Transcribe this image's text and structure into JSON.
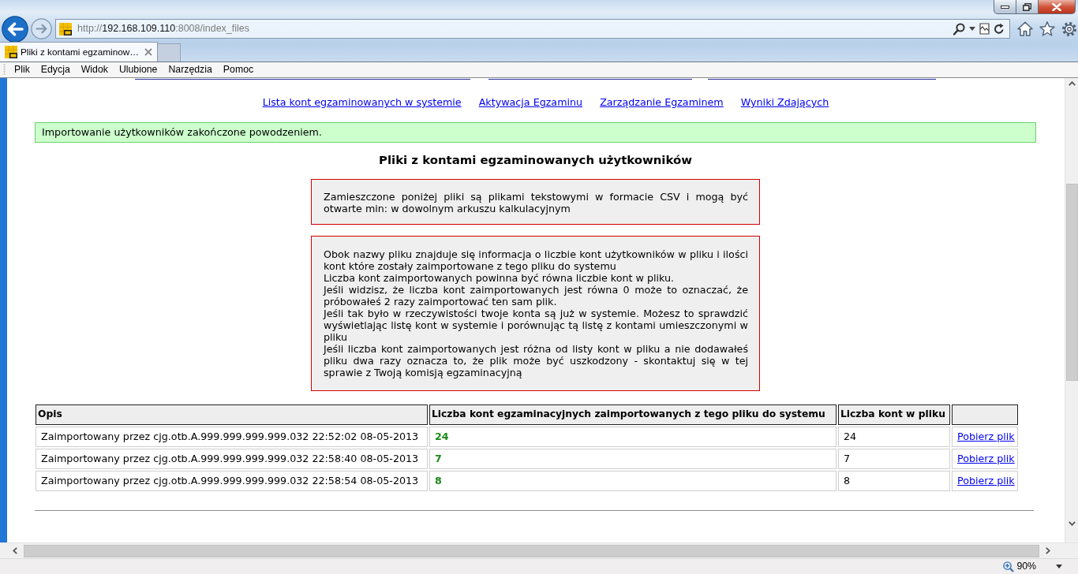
{
  "browser": {
    "address": {
      "scheme": "http://",
      "host": "192.168.109.110",
      "path": ":8008/index_files"
    },
    "tabs": [
      {
        "title": "Pliki z kontami egzaminow…",
        "selected": true
      }
    ],
    "menu": [
      "Plik",
      "Edycja",
      "Widok",
      "Ulubione",
      "Narzędzia",
      "Pomoc"
    ]
  },
  "page": {
    "nav_links": [
      "Lista kont egzaminowanych w systemie",
      "Aktywacja Egzaminu",
      "Zarządzanie Egzaminem",
      "Wyniki Zdających"
    ],
    "alert": "Importowanie użytkowników zakończone powodzeniem.",
    "heading": "Pliki z kontami egzaminowanych użytkowników",
    "notices": [
      {
        "paragraphs": [
          "Zamieszczone poniżej pliki są plikami tekstowymi w formacie CSV i mogą być otwarte min: w dowolnym arkuszu kalkulacyjnym"
        ]
      },
      {
        "paragraphs": [
          "Obok nazwy pliku znajduje się informacja o liczbie kont użytkowników w pliku i ilości kont które zostały zaimportowane z tego pliku do systemu",
          "Liczba kont zaimportowanych powinna być równa liczbie kont w pliku.",
          "Jeśli widzisz, że liczba kont zaimportowanych jest równa 0 może to oznaczać, że próbowałeś 2 razy zaimportować ten sam plik.",
          "Jeśli tak było w rzeczywistości twoje konta są już w systemie. Możesz to sprawdzić wyświetlając listę kont w systemie i porównując tą listę z kontami umieszczonymi w pliku",
          "Jeśli liczba kont zaimportowanych jest różna od listy kont w pliku a nie dodawałeś pliku dwa razy oznacza to, że plik może być uszkodzony - skontaktuj się w tej sprawie z Twoją komisją egzaminacyjną"
        ]
      }
    ],
    "table": {
      "columns": [
        "Opis",
        "Liczba kont egzaminacyjnych zaimportowanych z tego pliku do systemu",
        "Liczba kont w pliku"
      ],
      "rows": [
        {
          "description": "Zaimportowany przez cjg.otb.A.999.999.999.999.032 22:52:02 08-05-2013",
          "imported": "24",
          "in_file": "24",
          "action": "Pobierz plik"
        },
        {
          "description": "Zaimportowany przez cjg.otb.A.999.999.999.999.032 22:58:40 08-05-2013",
          "imported": "7",
          "in_file": "7",
          "action": "Pobierz plik"
        },
        {
          "description": "Zaimportowany przez cjg.otb.A.999.999.999.999.032 22:58:54 08-05-2013",
          "imported": "8",
          "in_file": "8",
          "action": "Pobierz plik"
        }
      ]
    }
  },
  "status_bar": {
    "zoom": "90%"
  }
}
